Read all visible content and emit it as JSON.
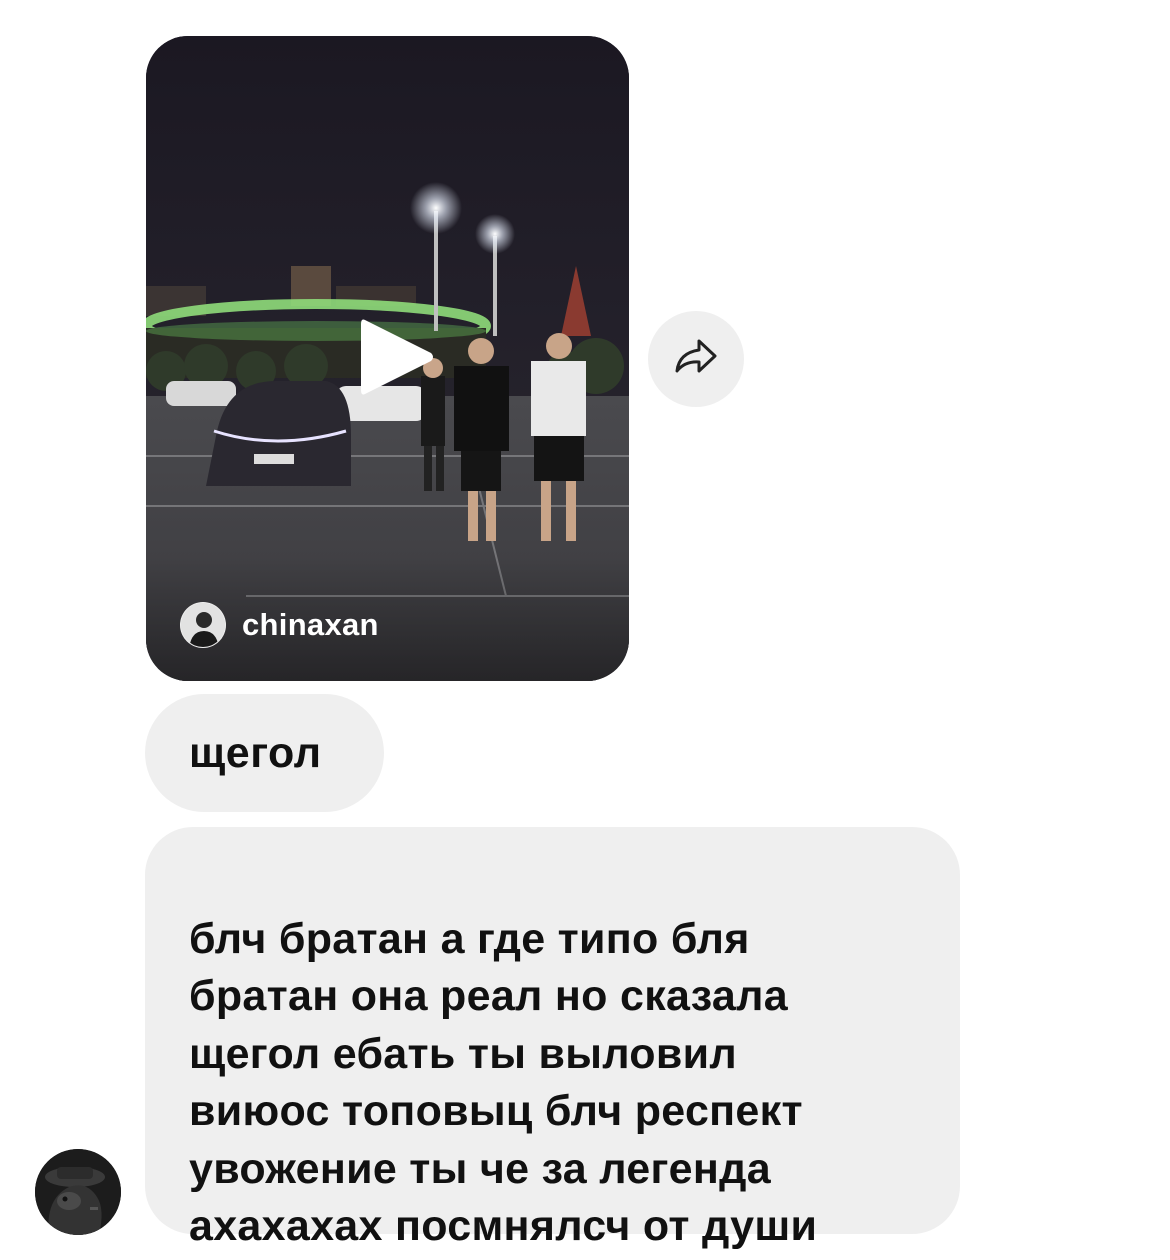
{
  "shared_reel": {
    "author": "chinaxan",
    "thumbnail_description_icon": "video-thumbnail",
    "play_icon": "play-icon"
  },
  "actions": {
    "share_icon": "share-arrow-icon"
  },
  "messages": [
    {
      "text": "щегол"
    },
    {
      "text": "блч братан а где типо бля\nбратан она реал но сказала\nщегол ебать ты выловил\nвиюос топовыц блч респект\nувожение ты че за легенда\nахахахах посмнялсч от души"
    }
  ],
  "colors": {
    "bubble_bg": "#efefef",
    "text": "#111111",
    "page_bg": "#ffffff"
  }
}
